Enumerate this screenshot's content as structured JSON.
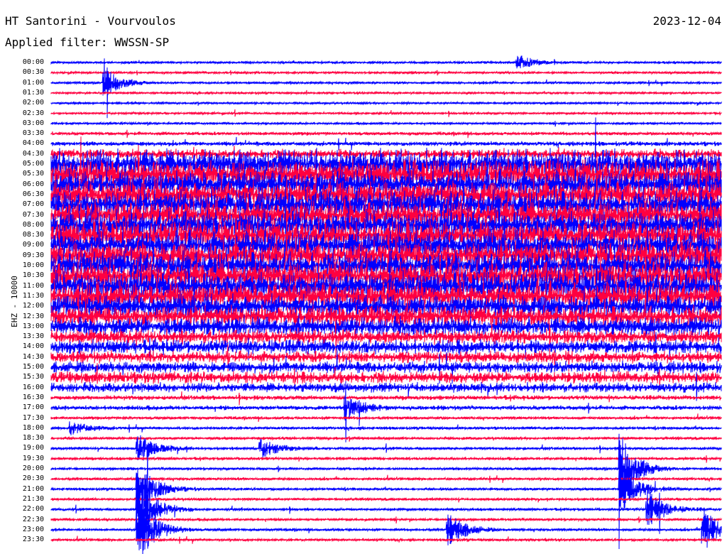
{
  "header": {
    "title": "HT Santorini - Vourvoulos",
    "date": "2023-12-04",
    "filter": "Applied filter: WWSSN-SP"
  },
  "chart_data": {
    "type": "line",
    "subtype": "helicorder",
    "title": "HT Santorini - Vourvoulos",
    "ylabel": "EHZ - 10000",
    "minutes_per_row": 30,
    "colors": [
      "#0000ff",
      "#ff0040"
    ],
    "row_labels": [
      "00:00",
      "00:30",
      "01:00",
      "01:30",
      "02:00",
      "02:30",
      "03:00",
      "03:30",
      "04:00",
      "04:30",
      "05:00",
      "05:30",
      "06:00",
      "06:30",
      "07:00",
      "07:30",
      "08:00",
      "08:30",
      "09:00",
      "09:30",
      "10:00",
      "10:30",
      "11:00",
      "11:30",
      "12:00",
      "12:30",
      "13:00",
      "13:30",
      "14:00",
      "14:30",
      "15:00",
      "15:30",
      "16:00",
      "16:30",
      "17:00",
      "17:30",
      "18:00",
      "18:30",
      "19:00",
      "19:30",
      "20:00",
      "20:30",
      "21:00",
      "21:30",
      "22:00",
      "22:30",
      "23:00",
      "23:30"
    ],
    "row_noise_level": [
      1,
      1,
      1,
      1,
      1,
      1,
      1,
      1.5,
      2,
      4,
      12,
      12,
      12,
      12,
      12,
      12,
      12,
      12,
      12,
      12,
      12,
      12,
      12,
      12,
      10,
      9,
      8,
      6,
      6,
      5,
      5,
      5,
      4,
      2,
      2,
      1.3,
      1.3,
      1.3,
      1.3,
      1.3,
      1.2,
      1.2,
      1.2,
      1.2,
      1.2,
      1.2,
      1.2,
      1.2
    ],
    "events": [
      {
        "row": 2,
        "minute": 2.5,
        "amp": 6
      },
      {
        "row": 0,
        "minute": 21,
        "amp": 3
      },
      {
        "row": 34,
        "minute": 13.3,
        "amp": 5
      },
      {
        "row": 38,
        "minute": 4,
        "amp": 6
      },
      {
        "row": 42,
        "minute": 4,
        "amp": 12
      },
      {
        "row": 44,
        "minute": 4,
        "amp": 14
      },
      {
        "row": 46,
        "minute": 4,
        "amp": 14
      },
      {
        "row": 40,
        "minute": 25.6,
        "amp": 14
      },
      {
        "row": 42,
        "minute": 25.6,
        "amp": 10
      },
      {
        "row": 44,
        "minute": 26.8,
        "amp": 8
      },
      {
        "row": 46,
        "minute": 17.9,
        "amp": 7
      },
      {
        "row": 46,
        "minute": 29.3,
        "amp": 9
      },
      {
        "row": 38,
        "minute": 9.5,
        "amp": 4
      },
      {
        "row": 36,
        "minute": 1,
        "amp": 3
      }
    ]
  }
}
